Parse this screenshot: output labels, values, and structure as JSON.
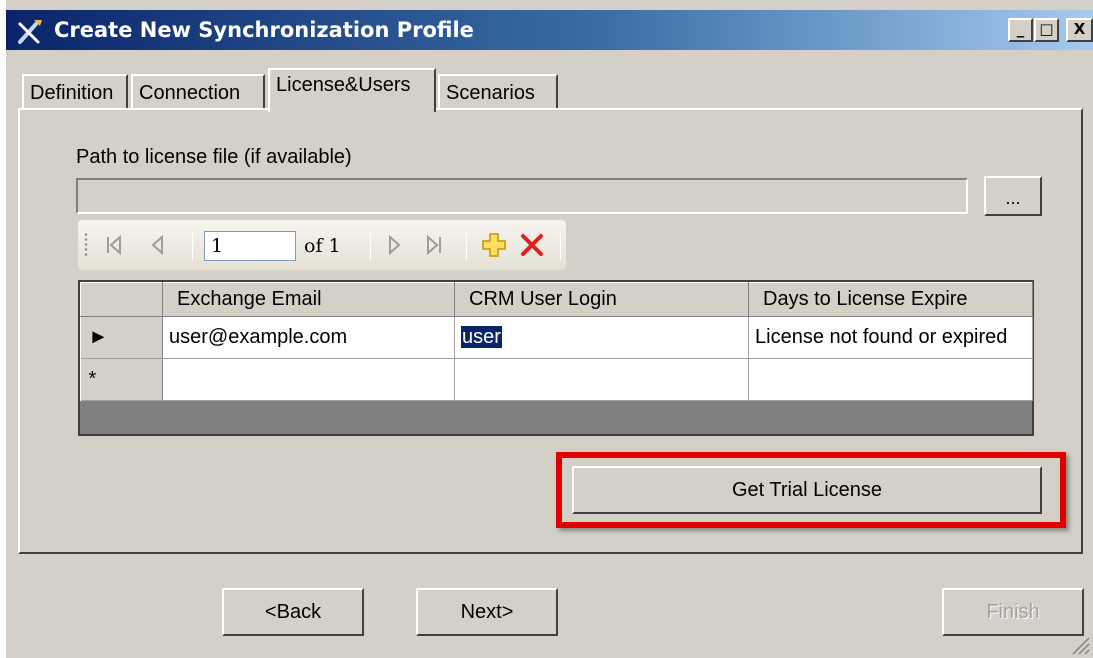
{
  "window": {
    "title": "Create New Synchronization Profile",
    "controls": {
      "minimize": "_",
      "maximize": "□",
      "close": "X"
    }
  },
  "tabs": [
    {
      "label": "Definition",
      "active": false
    },
    {
      "label": "Connection",
      "active": false
    },
    {
      "label": "License&Users",
      "active": true
    },
    {
      "label": "Scenarios",
      "active": false
    }
  ],
  "license": {
    "path_label": "Path to license file (if available)",
    "path_value": "",
    "browse_label": "..."
  },
  "navigator": {
    "position": "1",
    "of_label": "of 1",
    "icons": [
      "move-first-icon",
      "move-previous-icon",
      "move-next-icon",
      "move-last-icon",
      "add-new-icon",
      "delete-icon"
    ]
  },
  "grid": {
    "columns": [
      "Exchange Email",
      "CRM User Login",
      "Days to License Expire"
    ],
    "rows": [
      {
        "indicator": "►",
        "cells": [
          "user@example.com",
          "user",
          "License not found or expired"
        ]
      },
      {
        "indicator": "*",
        "cells": [
          "",
          "",
          ""
        ]
      }
    ]
  },
  "actions": {
    "trial_label": "Get Trial License",
    "back_label": "<Back",
    "next_label": "Next>",
    "finish_label": "Finish"
  },
  "colors": {
    "titlebar_start": "#0a246a",
    "titlebar_end": "#a6caf0",
    "face": "#d4d0c8",
    "highlight_frame": "#e00000",
    "selection": "#0a246a"
  }
}
